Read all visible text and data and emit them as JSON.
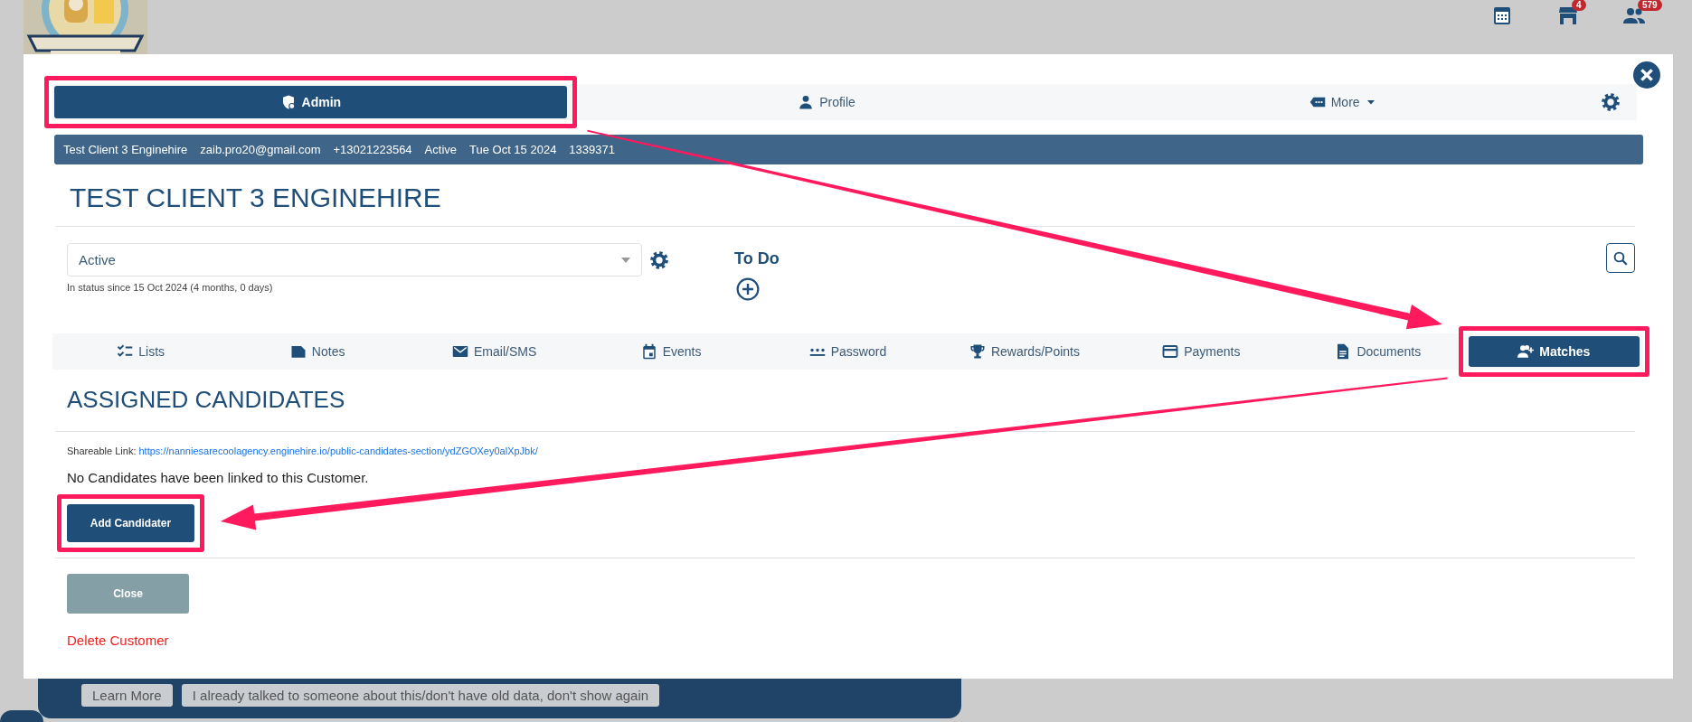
{
  "header": {
    "icons": [
      {
        "kind": "calendar"
      },
      {
        "kind": "store",
        "badge": "4"
      },
      {
        "kind": "people",
        "badge": "579"
      }
    ]
  },
  "modal": {
    "top_tabs": [
      {
        "label": "Admin",
        "kind": "shield",
        "selected": true,
        "highlighted": true
      },
      {
        "label": "Profile",
        "kind": "person",
        "selected": false,
        "highlighted": false
      },
      {
        "label": "More",
        "kind": "tag",
        "selected": false,
        "highlighted": false,
        "dropdown": true
      }
    ],
    "info_bar": [
      "Test Client 3 Enginehire",
      "zaib.pro20@gmail.com",
      "+13021223564",
      "Active",
      "Tue Oct 15 2024",
      "1339371"
    ],
    "title": "TEST CLIENT 3 ENGINEHIRE",
    "status_select": {
      "value": "Active"
    },
    "status_note": "In status since 15 Oct 2024 (4 months, 0 days)",
    "todo": {
      "title": "To Do"
    },
    "section_tabs": [
      {
        "label": "Lists",
        "kind": "checklist",
        "selected": false,
        "highlighted": false
      },
      {
        "label": "Notes",
        "kind": "note",
        "selected": false,
        "highlighted": false
      },
      {
        "label": "Email/SMS",
        "kind": "envelope",
        "selected": false,
        "highlighted": false
      },
      {
        "label": "Events",
        "kind": "event",
        "selected": false,
        "highlighted": false
      },
      {
        "label": "Password",
        "kind": "asterisks",
        "selected": false,
        "highlighted": false
      },
      {
        "label": "Rewards/Points",
        "kind": "trophy",
        "selected": false,
        "highlighted": false
      },
      {
        "label": "Payments",
        "kind": "card",
        "selected": false,
        "highlighted": false
      },
      {
        "label": "Documents",
        "kind": "document",
        "selected": false,
        "highlighted": false
      },
      {
        "label": "Matches",
        "kind": "adduser",
        "selected": true,
        "highlighted": true
      }
    ],
    "section": {
      "title": "ASSIGNED CANDIDATES",
      "share_label": "Shareable Link:",
      "share_url": "https://nanniesarecoolagency.enginehire.io/public-candidates-section/ydZGOXey0alXpJbk/",
      "empty_text": "No Candidates have been linked to this Customer.",
      "add_button": {
        "label": "Add Candidater",
        "highlighted": true
      }
    },
    "close_button": "Close",
    "delete_link": "Delete Customer"
  },
  "banner": {
    "buttons": [
      "Learn More",
      "I already talked to someone about this/don't have old data, don't show again"
    ]
  }
}
